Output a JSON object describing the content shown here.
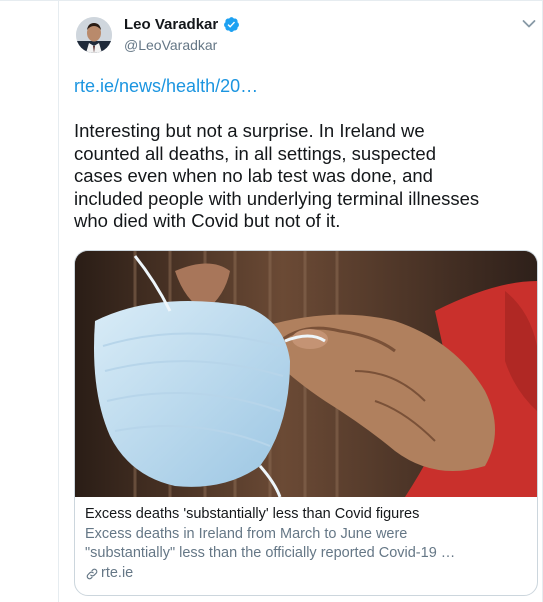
{
  "tweet": {
    "author_name": "Leo Varadkar",
    "author_handle": "@LeoVaradkar",
    "link": "rte.ie/news/health/20…",
    "body_lines": [
      "Interesting but not a surprise. In Ireland we",
      "counted all deaths, in all settings, suspected",
      "cases even when no lab test was done, and",
      "included people with underlying terminal illnesses",
      "who died with Covid but not of it."
    ]
  },
  "card": {
    "title": "Excess deaths 'substantially' less than Covid figures",
    "description_lines": [
      "Excess deaths in Ireland from March to June were",
      "\"substantially\" less than the officially reported Covid-19 …"
    ],
    "source": "rte.ie"
  },
  "icons": {
    "verified": "verified-badge-icon",
    "menu": "chevron-down-icon",
    "source_link": "link-icon"
  },
  "colors": {
    "link": "#1b95e0",
    "secondary_text": "#657786",
    "verified": "#1da1f2",
    "border": "#ccd6dd"
  }
}
